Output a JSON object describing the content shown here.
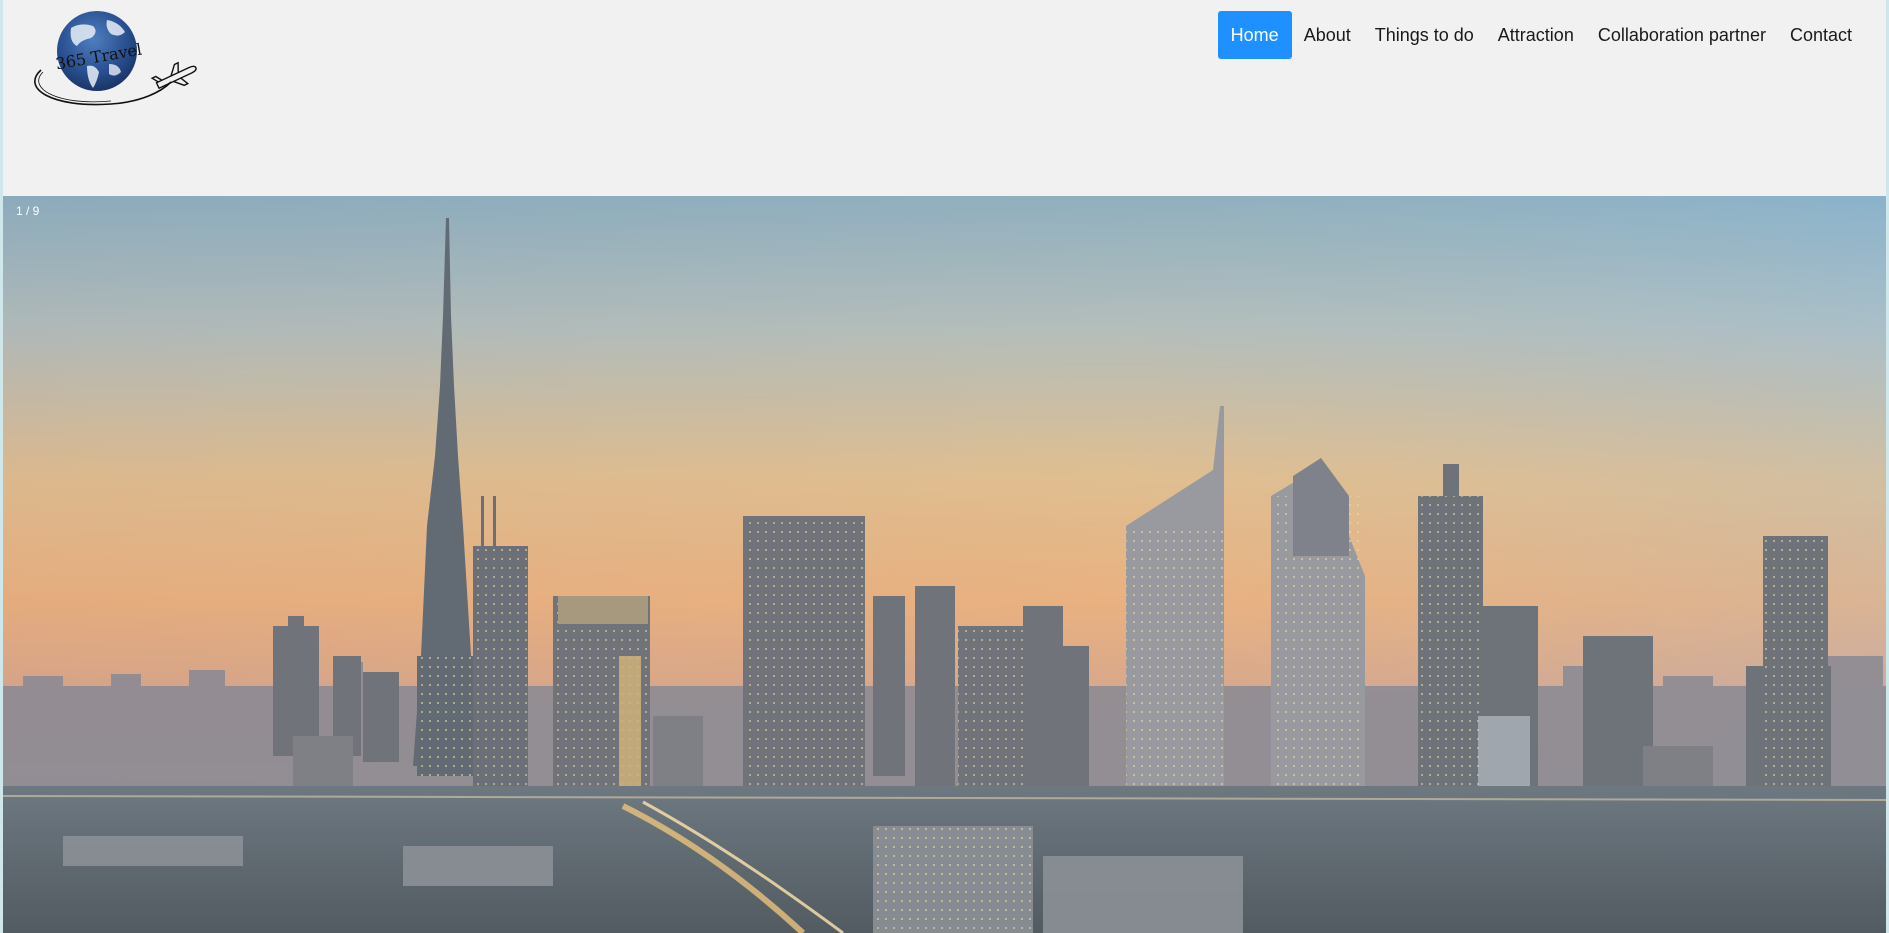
{
  "brand": {
    "logo_text": "365 Travel"
  },
  "nav": {
    "items": [
      {
        "label": "Home",
        "active": true
      },
      {
        "label": "About",
        "active": false
      },
      {
        "label": "Things to do",
        "active": false
      },
      {
        "label": "Attraction",
        "active": false
      },
      {
        "label": "Collaboration partner",
        "active": false
      },
      {
        "label": "Contact",
        "active": false
      }
    ]
  },
  "slideshow": {
    "counter": "1 / 9"
  },
  "colors": {
    "accent": "#1e90ff",
    "header_bg": "#f1f1f1"
  }
}
